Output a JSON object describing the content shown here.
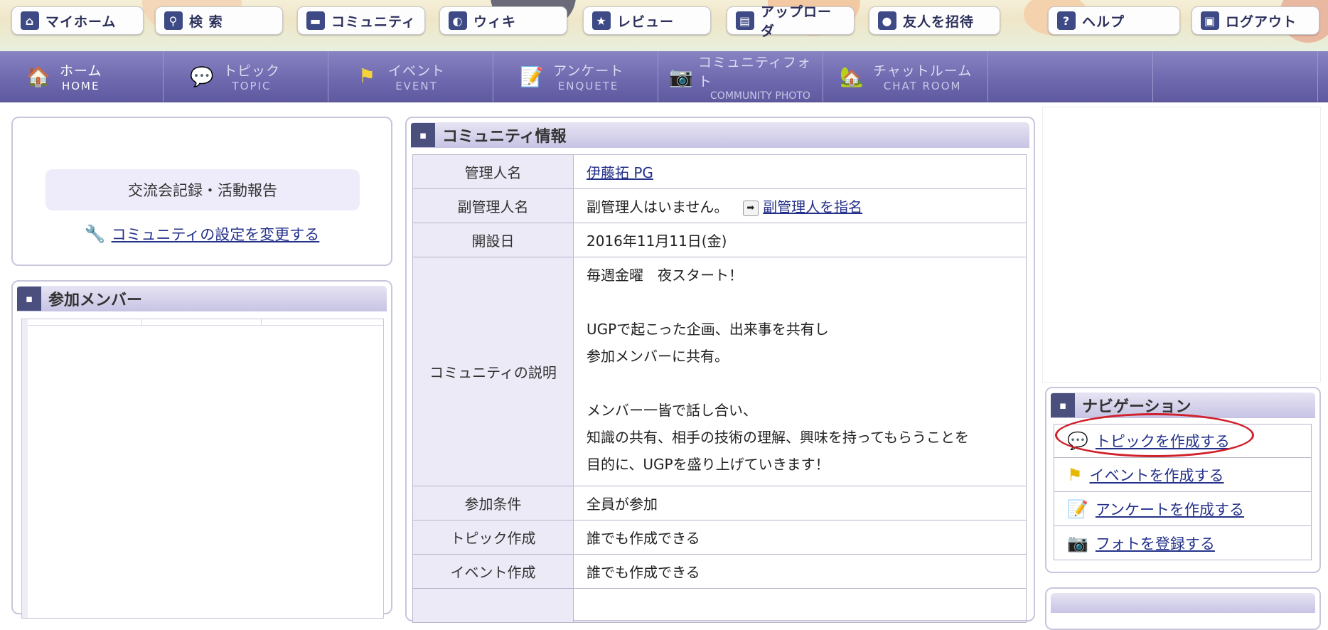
{
  "top_menu": [
    {
      "label": "マイホーム",
      "icon": "house-icon",
      "glyph": "⌂"
    },
    {
      "label": "検 索",
      "icon": "search-icon",
      "glyph": "⚲"
    },
    {
      "label": "コミュニティ",
      "icon": "chat-bubble-icon",
      "glyph": "▬"
    },
    {
      "label": "ウィキ",
      "icon": "wiki-icon",
      "glyph": "◐"
    },
    {
      "label": "レビュー",
      "icon": "star-icon",
      "glyph": "★"
    },
    {
      "label": "アップローダ",
      "icon": "upload-icon",
      "glyph": "▤"
    },
    {
      "label": "友人を招待",
      "icon": "person-icon",
      "glyph": "●"
    },
    {
      "label": "ヘルプ",
      "icon": "help-icon",
      "glyph": "?"
    },
    {
      "label": "ログアウト",
      "icon": "logout-icon",
      "glyph": "▣"
    }
  ],
  "main_nav": [
    {
      "jp": "ホーム",
      "en": "HOME",
      "icon": "home-icon",
      "glyph": "🏠"
    },
    {
      "jp": "トピック",
      "en": "TOPIC",
      "icon": "topic-icon",
      "glyph": "💬"
    },
    {
      "jp": "イベント",
      "en": "EVENT",
      "icon": "flag-icon",
      "glyph": "⚑"
    },
    {
      "jp": "アンケート",
      "en": "ENQUETE",
      "icon": "survey-icon",
      "glyph": "📝"
    },
    {
      "jp": "コミュニティフォト",
      "en": "COMMUNITY PHOTO",
      "icon": "camera-icon",
      "glyph": "📷"
    },
    {
      "jp": "チャットルーム",
      "en": "CHAT ROOM",
      "icon": "chat-room-icon",
      "glyph": "🏡"
    }
  ],
  "community": {
    "name_badge": "交流会記録・活動報告",
    "settings_link": "コミュニティの設定を変更する"
  },
  "members": {
    "title": "参加メンバー"
  },
  "info": {
    "title": "コミュニティ情報",
    "admin_label": "管理人名",
    "admin_value": "伊藤拓 PG",
    "sub_admin_label": "副管理人名",
    "sub_admin_value": "副管理人はいません。",
    "sub_admin_link": "副管理人を指名",
    "opened_label": "開設日",
    "opened_value": "2016年11月11日(金)",
    "description_label": "コミュニティの説明",
    "description_lines": [
      "毎週金曜　夜スタート！",
      "",
      "UGPで起こった企画、出来事を共有し",
      "参加メンバーに共有。",
      "",
      "メンバー一皆で話し合い、",
      "知識の共有、相手の技術の理解、興味を持ってもらうことを",
      "目的に、UGPを盛り上げていきます！"
    ],
    "join_label": "参加条件",
    "join_value": "全員が参加",
    "topic_label": "トピック作成",
    "topic_value": "誰でも作成できる",
    "event_label": "イベント作成",
    "event_value": "誰でも作成できる"
  },
  "navigation": {
    "title": "ナビゲーション",
    "items": [
      {
        "label": "トピックを作成する",
        "icon": "topic-add-icon",
        "glyph": "💬"
      },
      {
        "label": "イベントを作成する",
        "icon": "event-add-icon",
        "glyph": "⚑"
      },
      {
        "label": "アンケートを作成する",
        "icon": "survey-add-icon",
        "glyph": "📝"
      },
      {
        "label": "フォトを登録する",
        "icon": "photo-add-icon",
        "glyph": "📷"
      }
    ]
  },
  "colors": {
    "nav_bar": "#6f6aaf",
    "panel_header": "#c7c3e4",
    "table_label_bg": "#ebeaf6",
    "link": "#24318a",
    "highlight": "#d0202a"
  }
}
